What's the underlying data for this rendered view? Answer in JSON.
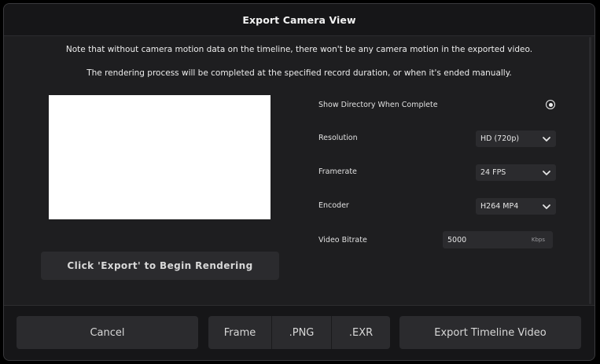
{
  "dialog": {
    "title": "Export Camera View"
  },
  "notes": {
    "line1": "Note that without camera motion data on the timeline, there won't be any camera motion in the exported video.",
    "line2": "The rendering process will be completed at the specified record duration, or when it's ended manually."
  },
  "preview": {
    "begin_label": "Click 'Export' to Begin Rendering"
  },
  "settings": {
    "show_directory_label": "Show Directory When Complete",
    "show_directory_selected": true,
    "resolution_label": "Resolution",
    "resolution_value": "HD (720p)",
    "framerate_label": "Framerate",
    "framerate_value": "24 FPS",
    "encoder_label": "Encoder",
    "encoder_value": "H264 MP4",
    "bitrate_label": "Video Bitrate",
    "bitrate_value": "5000",
    "bitrate_unit": "Kbps"
  },
  "footer": {
    "cancel_label": "Cancel",
    "frame_label": "Frame",
    "png_label": ".PNG",
    "exr_label": ".EXR",
    "export_label": "Export Timeline Video"
  },
  "icons": {
    "dropdown": "chevron-down-icon",
    "radio": "radio-selected-icon"
  },
  "colors": {
    "dialog_bg": "#1e1e20",
    "header_bg": "#161618",
    "control_bg": "#2b2b2e",
    "preview_bg": "#ffffff"
  }
}
